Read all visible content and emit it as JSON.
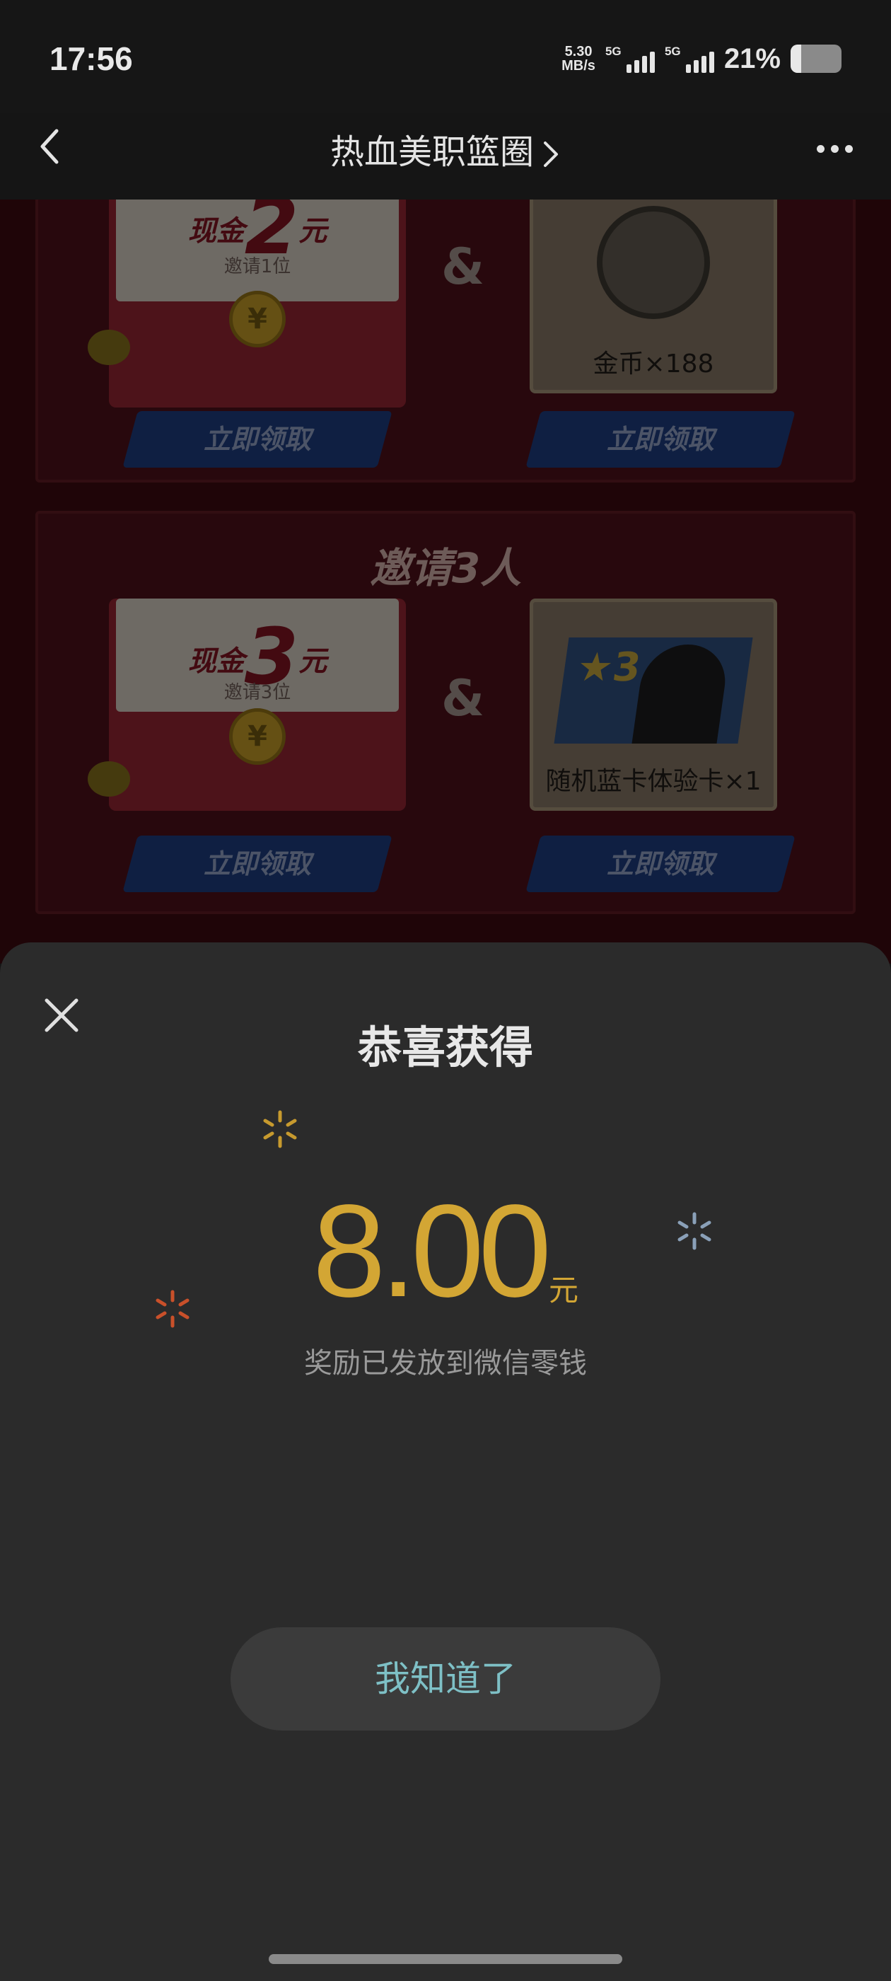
{
  "status_bar": {
    "time": "17:56",
    "net_speed_value": "5.30",
    "net_speed_unit": "MB/s",
    "sim1_type": "5G",
    "sim2_type": "5G",
    "battery_percent": "21%",
    "battery_level": 0.21
  },
  "nav": {
    "title": "热血美职篮圈"
  },
  "background": {
    "tier1": {
      "cash_prefix": "现金",
      "cash_amount": "2",
      "cash_unit": "元",
      "invite_note": "邀请1位",
      "reward_name": "金币×188",
      "claim_left": "立即领取",
      "claim_right": "立即领取"
    },
    "tier2": {
      "title": "邀请3人",
      "cash_prefix": "现金",
      "cash_amount": "3",
      "cash_unit": "元",
      "invite_note": "邀请3位",
      "card_star": "★3",
      "reward_name": "随机蓝卡体验卡×1",
      "claim_left": "立即领取",
      "claim_right": "立即领取"
    },
    "ampersand": "&",
    "coin_symbol": "¥"
  },
  "sheet": {
    "title": "恭喜获得",
    "amount": "8.00",
    "unit": "元",
    "note": "奖励已发放到微信零钱",
    "confirm_label": "我知道了"
  },
  "colors": {
    "amount": "#d3a634",
    "confirm_text": "#7ec0c6",
    "sheet_bg": "#2b2b2b"
  }
}
